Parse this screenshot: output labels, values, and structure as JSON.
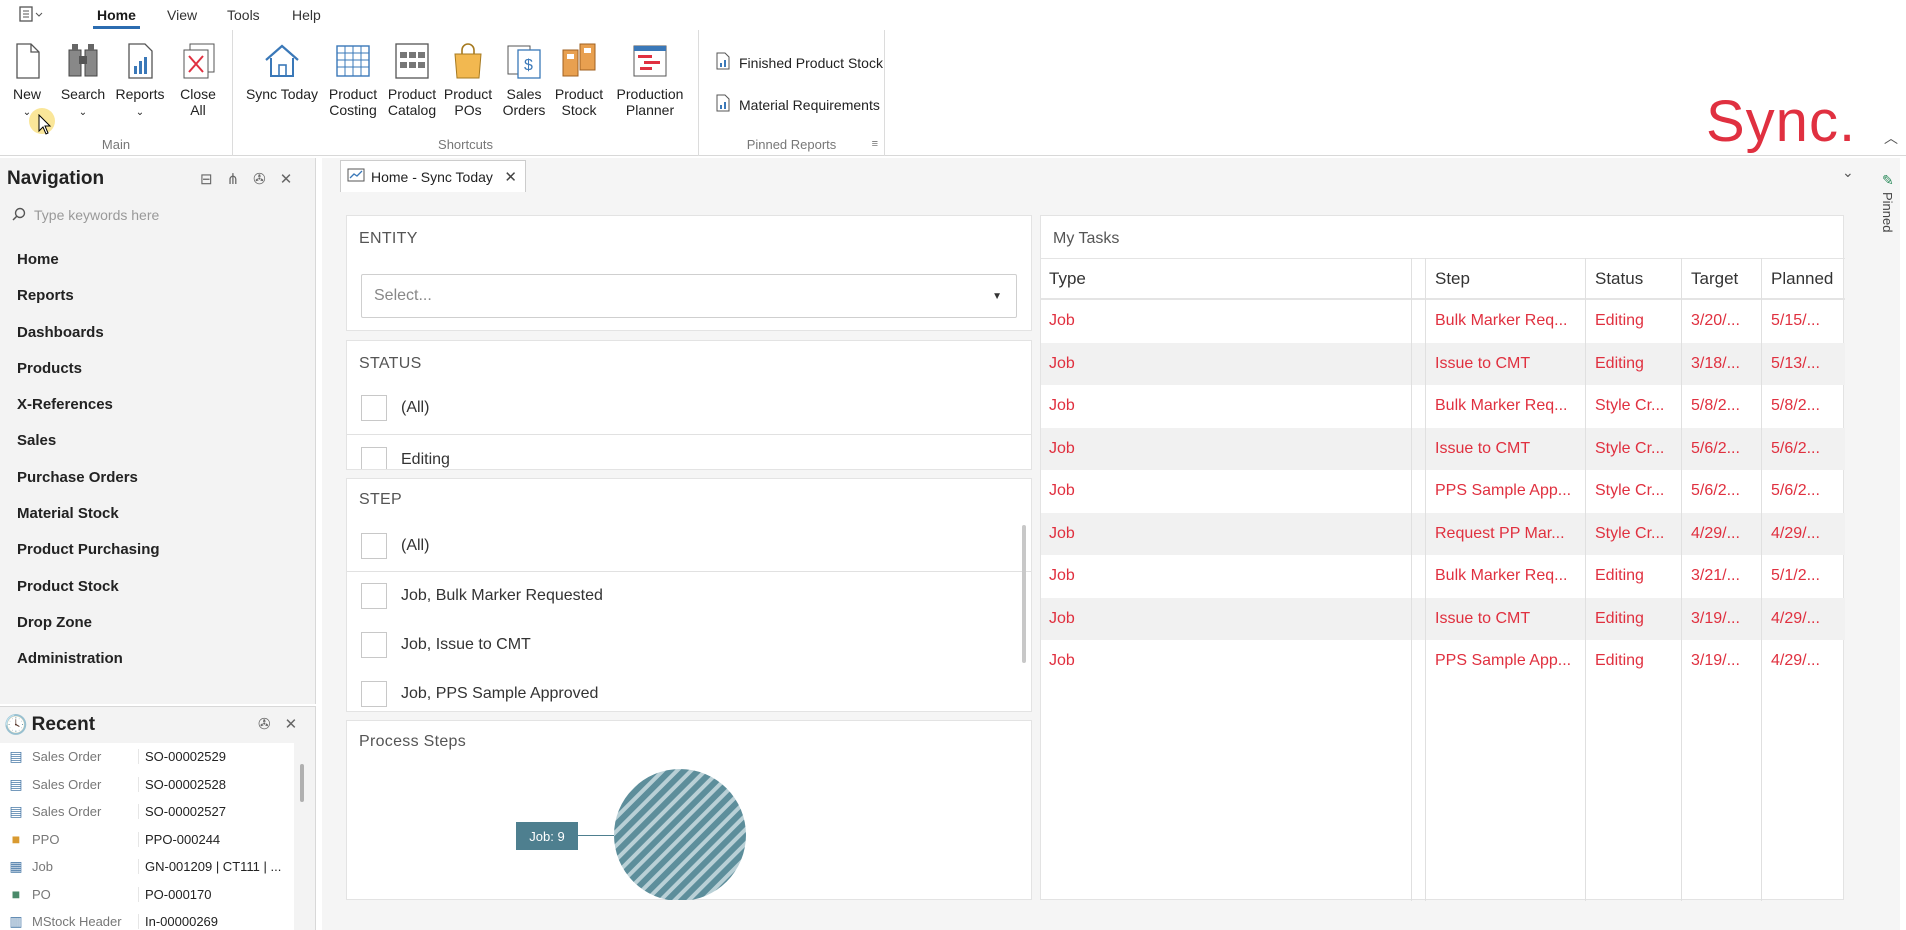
{
  "menubar": {
    "tabs": [
      {
        "label": "Home",
        "active": true
      },
      {
        "label": "View"
      },
      {
        "label": "Tools"
      },
      {
        "label": "Help"
      }
    ]
  },
  "ribbon": {
    "main": {
      "label": "Main",
      "buttons": [
        "New",
        "Search",
        "Reports",
        "Close\nAll"
      ]
    },
    "shortcuts": {
      "label": "Shortcuts",
      "buttons": [
        "Sync Today",
        "Product\nCosting",
        "Product\nCatalog",
        "Product\nPOs",
        "Sales\nOrders",
        "Product\nStock",
        "Production\nPlanner"
      ]
    },
    "pinned_reports": {
      "label": "Pinned Reports",
      "items": [
        "Finished Product Stock",
        "Material Requirements"
      ]
    },
    "logo": "Sync.",
    "brand_color": "#e03040"
  },
  "navigation": {
    "title": "Navigation",
    "search_placeholder": "Type keywords here",
    "items": [
      "Home",
      "Reports",
      "Dashboards",
      "Products",
      "X-References",
      "Sales",
      "Purchase Orders",
      "Material Stock",
      "Product Purchasing",
      "Product Stock",
      "Drop Zone",
      "Administration"
    ]
  },
  "recent": {
    "title": "Recent",
    "rows": [
      {
        "type": "Sales Order",
        "value": "SO-00002529",
        "icon": "sales-order-icon"
      },
      {
        "type": "Sales Order",
        "value": "SO-00002528",
        "icon": "sales-order-icon"
      },
      {
        "type": "Sales Order",
        "value": "SO-00002527",
        "icon": "sales-order-icon"
      },
      {
        "type": "PPO",
        "value": "PPO-000244",
        "icon": "bag-icon"
      },
      {
        "type": "Job",
        "value": "GN-001209 | CT111 | ...",
        "icon": "grid-icon"
      },
      {
        "type": "PO",
        "value": "PO-000170",
        "icon": "bag-icon"
      },
      {
        "type": "MStock Header",
        "value": "In-00000269",
        "icon": "stock-icon"
      }
    ]
  },
  "document": {
    "tab_label": "Home - Sync Today",
    "side_label": "Pinned"
  },
  "filters": {
    "entity": {
      "title": "ENTITY",
      "placeholder": "Select..."
    },
    "status": {
      "title": "STATUS",
      "options": [
        "(All)",
        "Editing"
      ]
    },
    "step": {
      "title": "STEP",
      "options": [
        "(All)",
        "Job, Bulk Marker Requested",
        "Job, Issue to CMT",
        "Job, PPS Sample Approved"
      ]
    },
    "process_steps": {
      "title": "Process Steps",
      "pie_label": "Job: 9"
    }
  },
  "chart_data": {
    "type": "pie",
    "title": "Process Steps",
    "labels": [
      "Job"
    ],
    "values": [
      9
    ]
  },
  "tasks": {
    "title": "My Tasks",
    "columns": [
      "Type",
      "Step",
      "Status",
      "Target",
      "Planned"
    ],
    "rows": [
      {
        "type": "Job",
        "step": "Bulk Marker Req...",
        "status": "Editing",
        "target": "3/20/...",
        "planned": "5/15/..."
      },
      {
        "type": "Job",
        "step": "Issue to CMT",
        "status": "Editing",
        "target": "3/18/...",
        "planned": "5/13/..."
      },
      {
        "type": "Job",
        "step": "Bulk Marker Req...",
        "status": "Style Cr...",
        "target": "5/8/2...",
        "planned": "5/8/2..."
      },
      {
        "type": "Job",
        "step": "Issue to CMT",
        "status": "Style Cr...",
        "target": "5/6/2...",
        "planned": "5/6/2..."
      },
      {
        "type": "Job",
        "step": "PPS Sample App...",
        "status": "Style Cr...",
        "target": "5/6/2...",
        "planned": "5/6/2..."
      },
      {
        "type": "Job",
        "step": "Request PP Mar...",
        "status": "Style Cr...",
        "target": "4/29/...",
        "planned": "4/29/..."
      },
      {
        "type": "Job",
        "step": "Bulk Marker Req...",
        "status": "Editing",
        "target": "3/21/...",
        "planned": "5/1/2..."
      },
      {
        "type": "Job",
        "step": "Issue to CMT",
        "status": "Editing",
        "target": "3/19/...",
        "planned": "4/29/..."
      },
      {
        "type": "Job",
        "step": "PPS Sample App...",
        "status": "Editing",
        "target": "3/19/...",
        "planned": "4/29/..."
      }
    ],
    "row_text_color": "#e0303f"
  }
}
